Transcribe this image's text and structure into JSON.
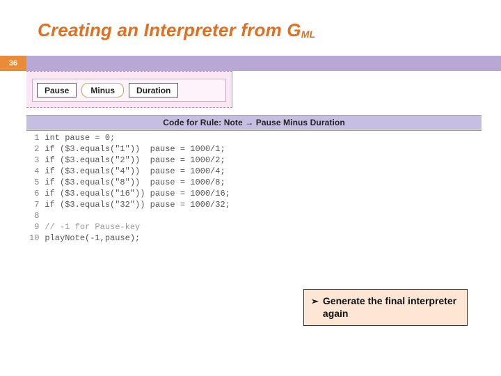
{
  "title_main": "Creating an Interpreter from G",
  "title_sub": "ML",
  "page_number": "36",
  "tokens": {
    "pause": "Pause",
    "minus": "Minus",
    "duration": "Duration"
  },
  "rule_header": "Code for Rule: Note → Pause Minus Duration",
  "code_lines": [
    "int pause = 0;",
    "if ($3.equals(\"1\"))  pause = 1000/1;",
    "if ($3.equals(\"2\"))  pause = 1000/2;",
    "if ($3.equals(\"4\"))  pause = 1000/4;",
    "if ($3.equals(\"8\"))  pause = 1000/8;",
    "if ($3.equals(\"16\")) pause = 1000/16;",
    "if ($3.equals(\"32\")) pause = 1000/32;",
    "",
    "// -1 for Pause-key",
    "playNote(-1,pause);"
  ],
  "annotation": {
    "bullet": "➢",
    "text": "Generate the final interpreter again"
  }
}
